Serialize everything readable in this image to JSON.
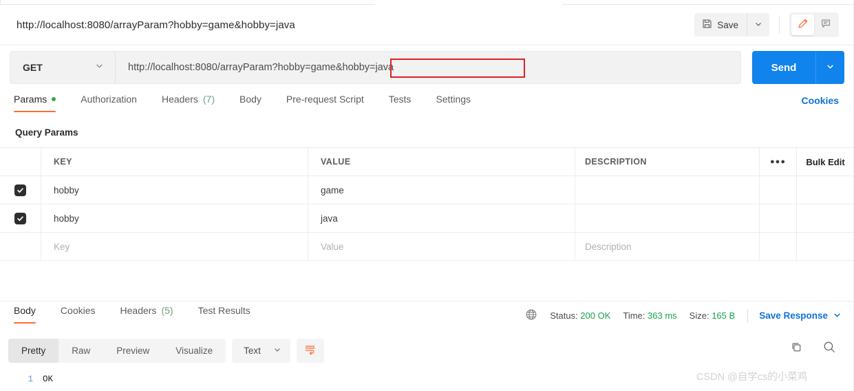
{
  "header": {
    "request_title": "http://localhost:8080/arrayParam?hobby=game&hobby=java",
    "save_label": "Save",
    "save_icon": "floppy-disk-icon",
    "save_caret_icon": "chevron-down-icon",
    "edit_icon": "pencil-icon",
    "comment_icon": "comment-icon"
  },
  "url_bar": {
    "method": "GET",
    "method_caret_icon": "chevron-down-icon",
    "url": "http://localhost:8080/arrayParam?hobby=game&hobby=java",
    "url_prefix": "http://localhost:8080/arrayParam?",
    "url_highlight": "hobby=game&hobby=java",
    "send_label": "Send",
    "send_caret_icon": "chevron-down-icon",
    "annotation_color": "#e02020",
    "send_color": "#1183ec"
  },
  "request_tabs": {
    "items": [
      {
        "label": "Params",
        "badge": "",
        "dot": true,
        "active": true
      },
      {
        "label": "Authorization",
        "badge": "",
        "dot": false,
        "active": false
      },
      {
        "label": "Headers",
        "badge": "(7)",
        "dot": false,
        "active": false
      },
      {
        "label": "Body",
        "badge": "",
        "dot": false,
        "active": false
      },
      {
        "label": "Pre-request Script",
        "badge": "",
        "dot": false,
        "active": false
      },
      {
        "label": "Tests",
        "badge": "",
        "dot": false,
        "active": false
      },
      {
        "label": "Settings",
        "badge": "",
        "dot": false,
        "active": false
      }
    ],
    "cookies_link": "Cookies",
    "active_underline_color": "#ff6c37",
    "dot_color": "#2fa84f"
  },
  "query_params": {
    "section_title": "Query Params",
    "columns": [
      "KEY",
      "VALUE",
      "DESCRIPTION"
    ],
    "options_icon": "more-options-icon",
    "bulk_edit_label": "Bulk Edit",
    "rows": [
      {
        "checked": true,
        "key": "hobby",
        "value": "game",
        "description": ""
      },
      {
        "checked": true,
        "key": "hobby",
        "value": "java",
        "description": ""
      }
    ],
    "empty_row": {
      "key": "Key",
      "value": "Value",
      "description": "Description"
    }
  },
  "response": {
    "tabs": [
      {
        "label": "Body",
        "badge": "",
        "active": true
      },
      {
        "label": "Cookies",
        "badge": "",
        "active": false
      },
      {
        "label": "Headers",
        "badge": "(5)",
        "active": false
      },
      {
        "label": "Test Results",
        "badge": "",
        "active": false
      }
    ],
    "globe_icon": "globe-icon",
    "status_label": "Status:",
    "status_value": "200 OK",
    "time_label": "Time:",
    "time_value": "363 ms",
    "size_label": "Size:",
    "size_value": "165 B",
    "save_response_label": "Save Response",
    "save_response_caret_icon": "chevron-down-icon",
    "meta_value_color": "#16a34a",
    "link_color": "#0f72d6"
  },
  "body_toolbar": {
    "views": [
      {
        "label": "Pretty",
        "active": true
      },
      {
        "label": "Raw",
        "active": false
      },
      {
        "label": "Preview",
        "active": false
      },
      {
        "label": "Visualize",
        "active": false
      }
    ],
    "format": "Text",
    "format_caret_icon": "chevron-down-icon",
    "wrap_icon": "word-wrap-icon",
    "copy_icon": "copy-icon",
    "search_icon": "search-icon"
  },
  "body_content": {
    "lines": [
      {
        "no": "1",
        "text": "OK"
      }
    ]
  },
  "watermark": {
    "text": "CSDN @自学cs的小菜鸡"
  }
}
